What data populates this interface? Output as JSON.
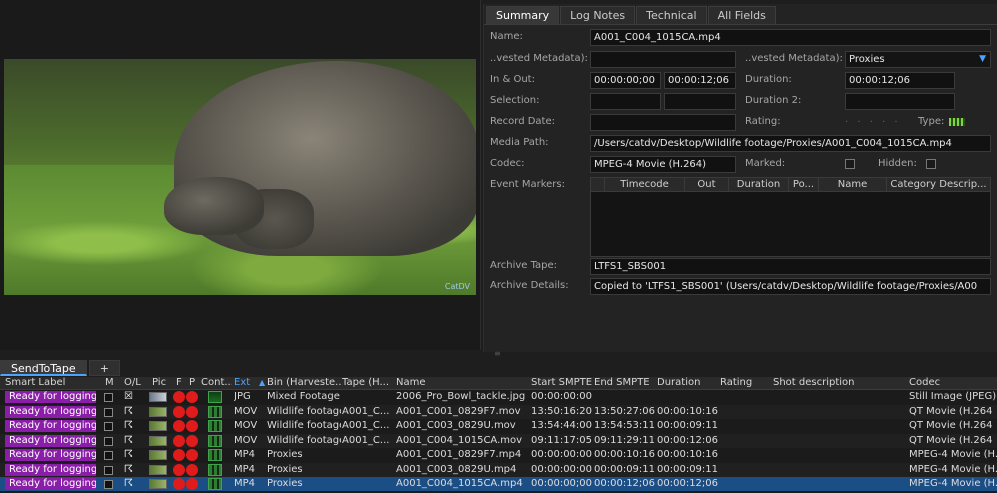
{
  "meta_tabs": [
    "Summary",
    "Log Notes",
    "Technical",
    "All Fields"
  ],
  "video": {
    "watermark": "CatDV"
  },
  "summary": {
    "name_label": "Name:",
    "name_value": "A001_C004_1015CA.mp4",
    "harvested_left_label": "..vested Metadata):",
    "harvested_left_value": "",
    "harvested_right_label": "..vested Metadata):",
    "harvested_right_value": "Proxies",
    "in_out_label": "In & Out:",
    "in_value": "00:00:00;00",
    "out_value": "00:00:12;06",
    "duration_label": "Duration:",
    "duration_value": "00:00:12;06",
    "selection_label": "Selection:",
    "duration2_label": "Duration 2:",
    "record_date_label": "Record Date:",
    "rating_label": "Rating:",
    "rating_dots": ". . . . .",
    "type_label": "Type:",
    "media_path_label": "Media Path:",
    "media_path_value": "/Users/catdv/Desktop/Wildlife footage/Proxies/A001_C004_1015CA.mp4",
    "codec_label": "Codec:",
    "codec_value": "MPEG-4 Movie (H.264)",
    "marked_label": "Marked:",
    "hidden_label": "Hidden:",
    "event_markers_label": "Event Markers:",
    "marker_columns": [
      "",
      "Timecode",
      "Out",
      "Duration",
      "Po...",
      "Name",
      "Category Descrip..."
    ],
    "archive_tape_label": "Archive Tape:",
    "archive_tape_value": "LTFS1_SBS001",
    "archive_details_label": "Archive Details:",
    "archive_details_value": "Copied to 'LTFS1_SBS001' (Users/catdv/Desktop/Wildlife footage/Proxies/A00"
  },
  "list_tabs": [
    "SendToTape",
    "+"
  ],
  "columns": {
    "smart_label": "Smart Label",
    "m": "M",
    "ol": "O/L",
    "pic": "Pic",
    "f": "F",
    "p": "P",
    "cont": "Cont...",
    "ext": "Ext",
    "bin": "Bin (Harveste...",
    "tape": "Tape (H...",
    "name": "Name",
    "start": "Start SMPTE",
    "end": "End SMPTE",
    "duration": "Duration",
    "rating": "Rating",
    "shot": "Shot description",
    "codec": "Codec"
  },
  "rows": [
    {
      "smart": "Ready for logging",
      "ext": "JPG",
      "bin": "Mixed Footage",
      "tape": "",
      "name": "2006_Pro_Bowl_tackle.jpg",
      "start": "00:00:00:00",
      "end": "",
      "duration": "",
      "codec": "Still Image (JPEG)",
      "selected": false,
      "image": true
    },
    {
      "smart": "Ready for logging",
      "ext": "MOV",
      "bin": "Wildlife footage",
      "tape": "A001_C...",
      "name": "A001_C001_0829F7.mov",
      "start": "13:50:16:20",
      "end": "13:50:27:06",
      "duration": "00:00:10:16",
      "codec": "QT Movie (H.264",
      "selected": false,
      "image": false
    },
    {
      "smart": "Ready for logging",
      "ext": "MOV",
      "bin": "Wildlife footage",
      "tape": "A001_C...",
      "name": "A001_C003_0829U.mov",
      "start": "13:54:44:00",
      "end": "13:54:53:11",
      "duration": "00:00:09:11",
      "codec": "QT Movie (H.264",
      "selected": false,
      "image": false
    },
    {
      "smart": "Ready for logging",
      "ext": "MOV",
      "bin": "Wildlife footage",
      "tape": "A001_C...",
      "name": "A001_C004_1015CA.mov",
      "start": "09:11:17:05",
      "end": "09:11:29:11",
      "duration": "00:00:12:06",
      "codec": "QT Movie (H.264",
      "selected": false,
      "image": false
    },
    {
      "smart": "Ready for logging",
      "ext": "MP4",
      "bin": "Proxies",
      "tape": "",
      "name": "A001_C001_0829F7.mp4",
      "start": "00:00:00:00",
      "end": "00:00:10:16",
      "duration": "00:00:10:16",
      "codec": "MPEG-4 Movie (H.264",
      "selected": false,
      "image": false
    },
    {
      "smart": "Ready for logging",
      "ext": "MP4",
      "bin": "Proxies",
      "tape": "",
      "name": "A001_C003_0829U.mp4",
      "start": "00:00:00:00",
      "end": "00:00:09:11",
      "duration": "00:00:09:11",
      "codec": "MPEG-4 Movie (H.264",
      "selected": false,
      "image": false
    },
    {
      "smart": "Ready for logging",
      "ext": "MP4",
      "bin": "Proxies",
      "tape": "",
      "name": "A001_C004_1015CA.mp4",
      "start": "00:00:00;00",
      "end": "00:00:12;06",
      "duration": "00:00:12;06",
      "codec": "MPEG-4 Movie (H.264",
      "selected": true,
      "image": false
    }
  ]
}
